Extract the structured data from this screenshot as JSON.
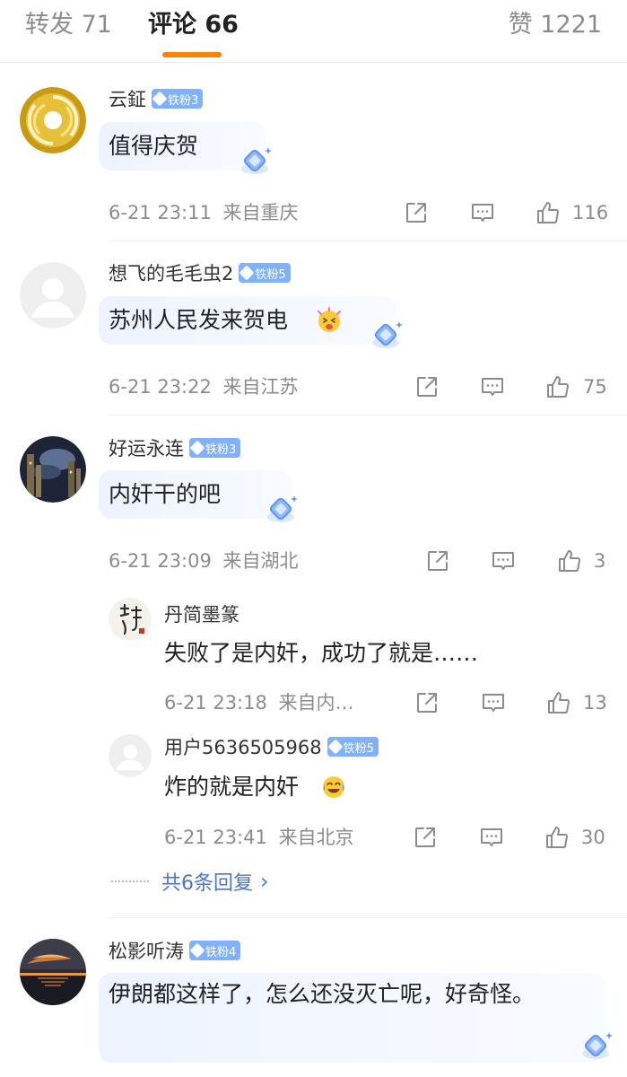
{
  "tabs": {
    "repost": "转发 71",
    "comments": "评论 66",
    "likes": "赞 1221"
  },
  "colors": {
    "accent": "#ff8200",
    "badge": "#7fb1ff",
    "link": "#4a78c6"
  },
  "comments": [
    {
      "username": "云鉦",
      "badge": "铁粉3",
      "text": "值得庆贺",
      "time": "6-21 23:11",
      "location": "来自重庆",
      "likes": "116",
      "avatar": "golden-swirl-avatar"
    },
    {
      "username": "想飞的毛毛虫2",
      "badge": "铁粉5",
      "text": "苏州人民发来贺电",
      "emoji": "celebrate-emoji",
      "time": "6-21 23:22",
      "location": "来自江苏",
      "likes": "75",
      "avatar": "default-avatar"
    },
    {
      "username": "好运永连",
      "badge": "铁粉3",
      "text": "内奸干的吧",
      "time": "6-21 23:09",
      "location": "来自湖北",
      "likes": "3",
      "avatar": "night-sky-avatar",
      "replies": [
        {
          "username": "丹简墨篆",
          "text": "失败了是内奸，成功了就是……",
          "time": "6-21 23:18",
          "location": "来自内…",
          "likes": "13",
          "avatar": "calligraphy-avatar"
        },
        {
          "username": "用户5636505968",
          "badge": "铁粉5",
          "text": "炸的就是内奸",
          "emoji": "laugh-cry-emoji",
          "time": "6-21 23:41",
          "location": "来自北京",
          "likes": "30",
          "avatar": "default-avatar"
        }
      ],
      "more_replies": "共6条回复"
    },
    {
      "username": "松影听涛",
      "badge": "铁粉4",
      "text": "伊朗都这样了，怎么还没灭亡呢，好奇怪。",
      "avatar": "sunset-lake-avatar"
    }
  ]
}
